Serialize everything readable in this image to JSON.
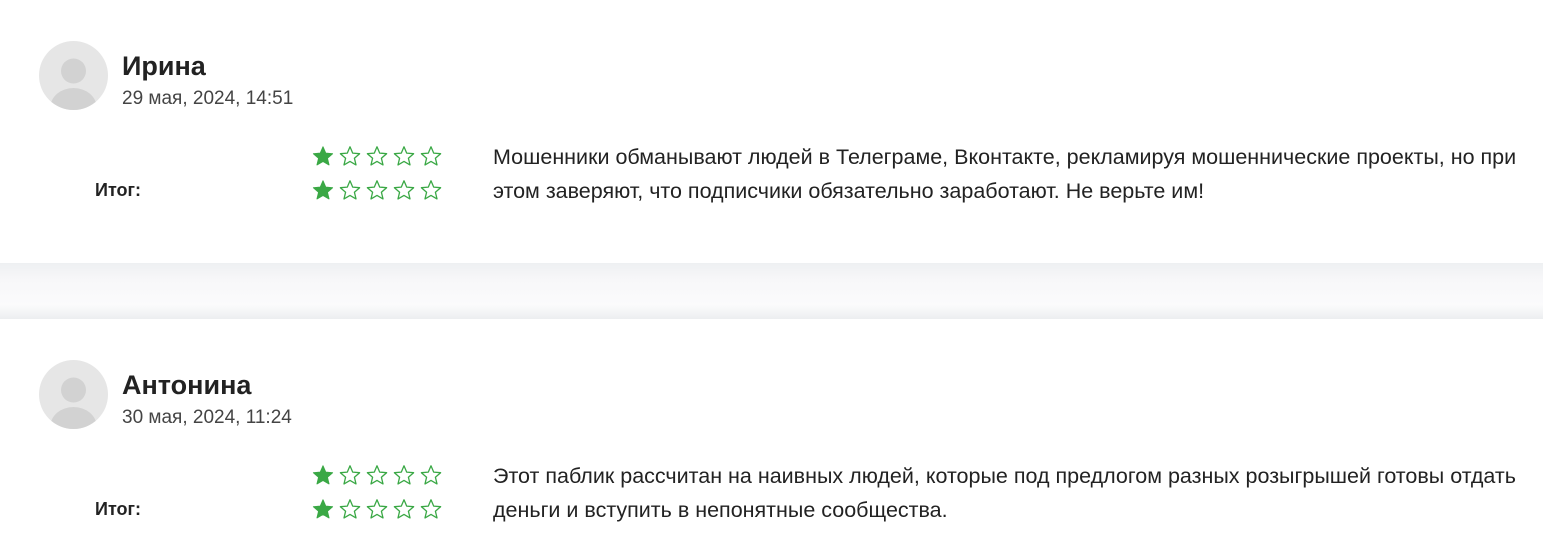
{
  "reviews": [
    {
      "author": "Ирина",
      "date": "29 мая, 2024, 14:51",
      "total_label": "Итог:",
      "ratings": [
        1,
        1
      ],
      "max_rating": 5,
      "comment": "Мошенники обманывают людей в Телеграме, Вконтакте, рекламируя мошеннические проекты, но при этом заверяют, что подписчики обязательно заработают. Не верьте им!"
    },
    {
      "author": "Антонина",
      "date": "30 мая, 2024, 11:24",
      "total_label": "Итог:",
      "ratings": [
        1,
        1
      ],
      "max_rating": 5,
      "comment": "Этот паблик рассчитан на наивных людей, которые под предлогом разных розыгрышей готовы отдать деньги и вступить в непонятные сообщества."
    }
  ],
  "colors": {
    "star_accent": "#3aa845",
    "avatar_bg": "#e6e6e6",
    "avatar_figure": "#d2d2d2"
  },
  "icons": {
    "avatar": "user-silhouette-icon",
    "star_filled": "star-filled-icon",
    "star_empty": "star-outline-icon"
  }
}
